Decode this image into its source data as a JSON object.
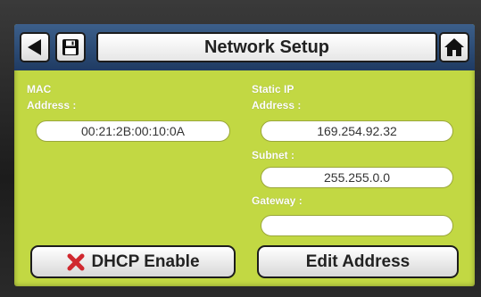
{
  "header": {
    "title": "Network Setup",
    "back_icon": "back-arrow-icon",
    "save_icon": "floppy-disk-icon",
    "home_icon": "home-icon"
  },
  "mac": {
    "label_line1": "MAC",
    "label_line2": "Address :",
    "value": "00:21:2B:00:10:0A"
  },
  "static_ip": {
    "label_line1": "Static IP",
    "label_line2": "Address :",
    "value": "169.254.92.32"
  },
  "subnet": {
    "label": "Subnet :",
    "value": "255.255.0.0"
  },
  "gateway": {
    "label": "Gateway :",
    "value": ""
  },
  "buttons": {
    "dhcp_label": "DHCP Enable",
    "dhcp_icon": "red-x-icon",
    "edit_label": "Edit Address"
  },
  "colors": {
    "screen_bg": "#c2d843",
    "header_bg": "#2b4a76",
    "dhcp_x": "#d0282f"
  }
}
